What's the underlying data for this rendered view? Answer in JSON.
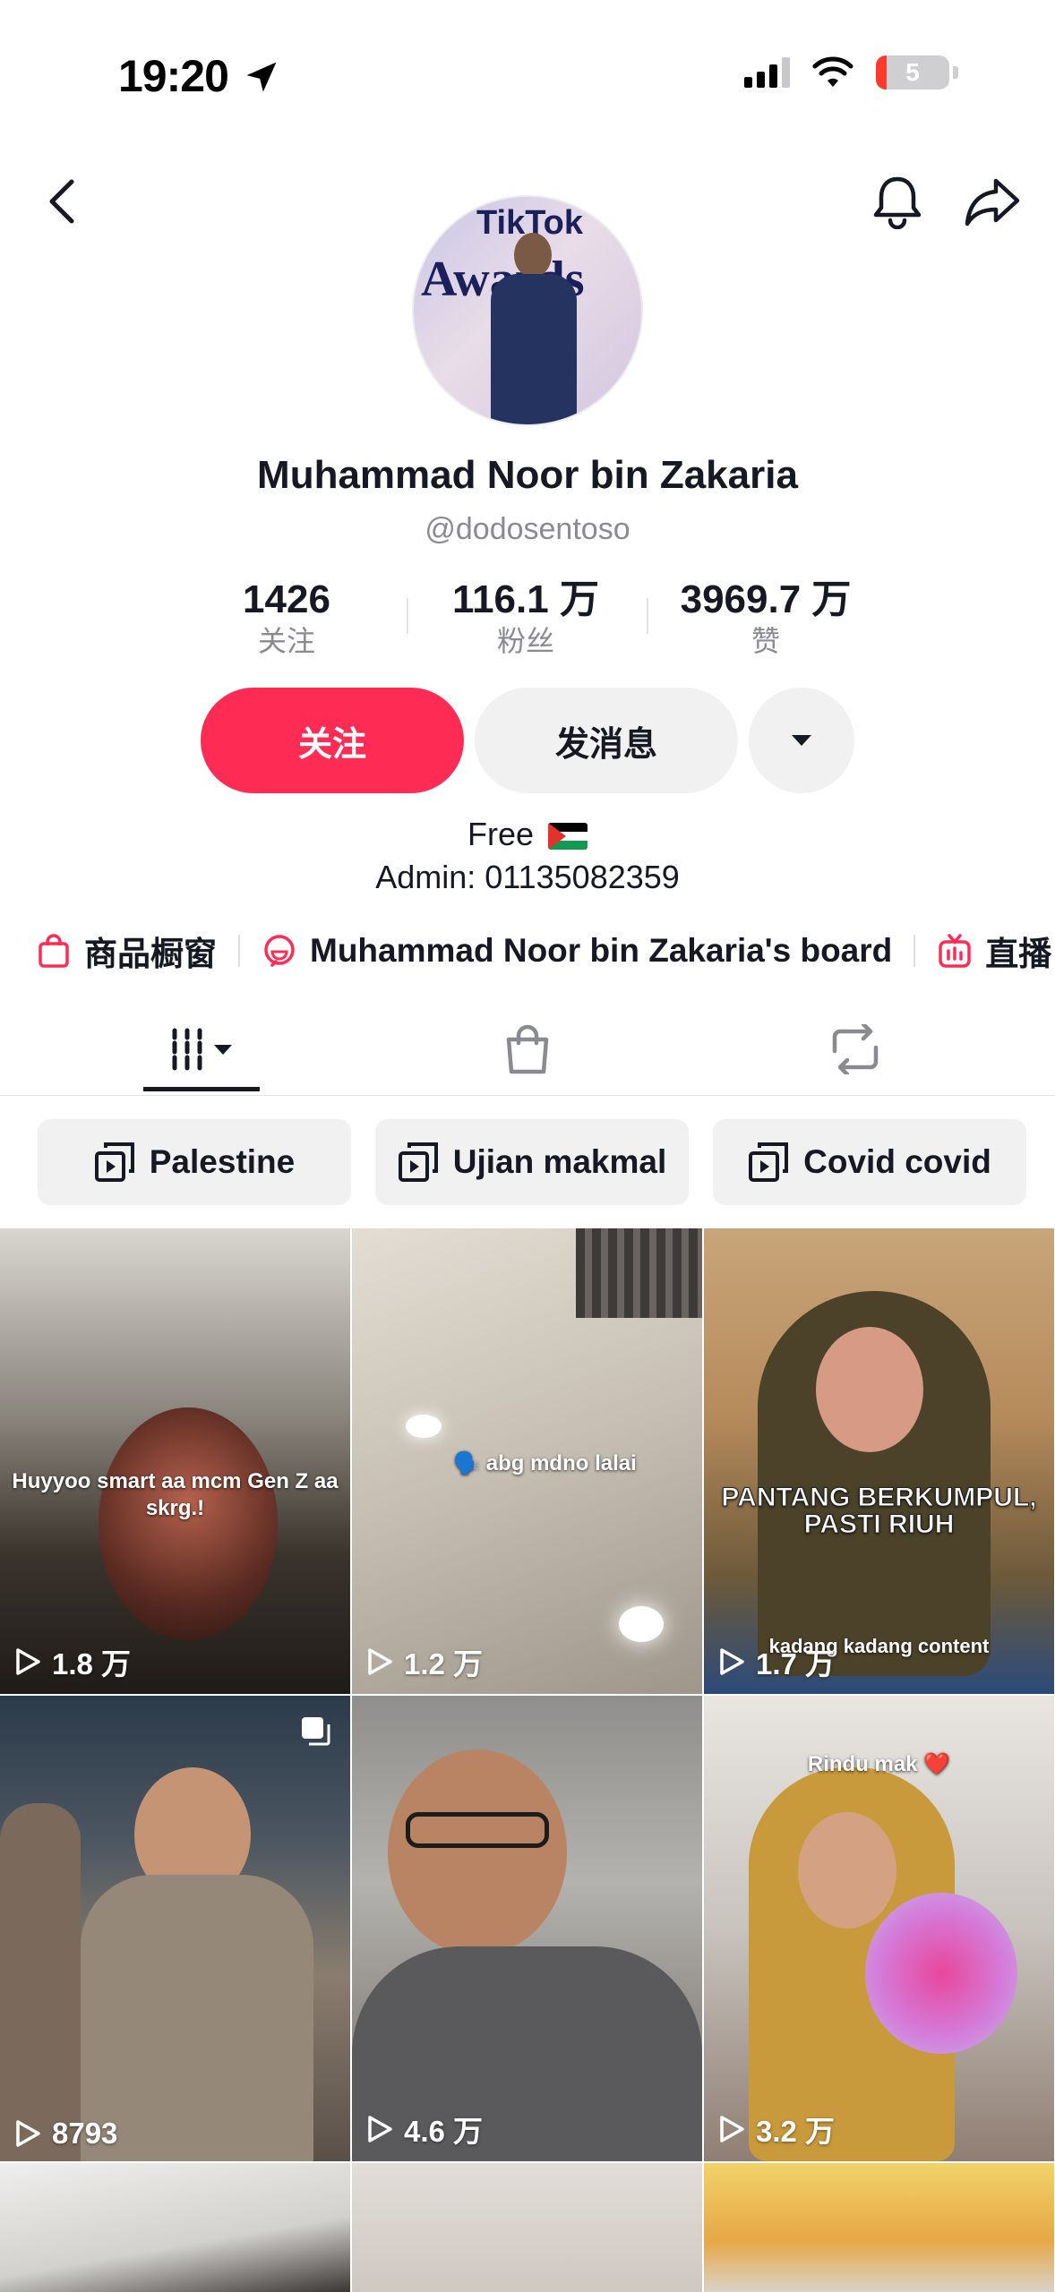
{
  "status_bar": {
    "time": "19:20",
    "battery": "5"
  },
  "profile": {
    "name": "Muhammad Noor bin Zakaria",
    "handle": "@dodosentoso",
    "avatar_text_1": "Awards",
    "avatar_text_2": "TikTok"
  },
  "stats": [
    {
      "value": "1426",
      "label": "关注"
    },
    {
      "value": "116.1 万",
      "label": "粉丝"
    },
    {
      "value": "3969.7 万",
      "label": "赞"
    }
  ],
  "actions": {
    "follow": "关注",
    "message": "发消息"
  },
  "bio": {
    "line1": "Free",
    "line2": "Admin: 01135082359"
  },
  "links": [
    {
      "icon": "shopping-bag-icon",
      "label": "商品橱窗"
    },
    {
      "icon": "board-icon",
      "label": "Muhammad Noor bin Zakaria's board"
    },
    {
      "icon": "live-tv-icon",
      "label": "直播"
    }
  ],
  "tabs": [
    {
      "icon": "videos-grid-icon",
      "active": true
    },
    {
      "icon": "shopping-bag-icon",
      "active": false
    },
    {
      "icon": "repost-icon",
      "active": false
    }
  ],
  "playlists": [
    "Palestine",
    "Ujian makmal",
    "Covid covid"
  ],
  "videos": [
    {
      "views": "1.8 万",
      "caption": "Huyyoo smart aa mcm Gen Z aa skrg.!"
    },
    {
      "views": "1.2 万",
      "caption": "🗣️ abg mdno lalai"
    },
    {
      "views": "1.7 万",
      "caption": "PANTANG BERKUMPUL, PASTI RIUH",
      "caption2": "kadang kadang content"
    },
    {
      "views": "8793",
      "caption": ""
    },
    {
      "views": "4.6 万",
      "caption": ""
    },
    {
      "views": "3.2 万",
      "caption": "Rindu mak ❤️"
    }
  ],
  "colors": {
    "accent": "#fe2c55",
    "text": "#161823",
    "muted": "#8a8b91",
    "chip_bg": "#f1f1f2"
  }
}
